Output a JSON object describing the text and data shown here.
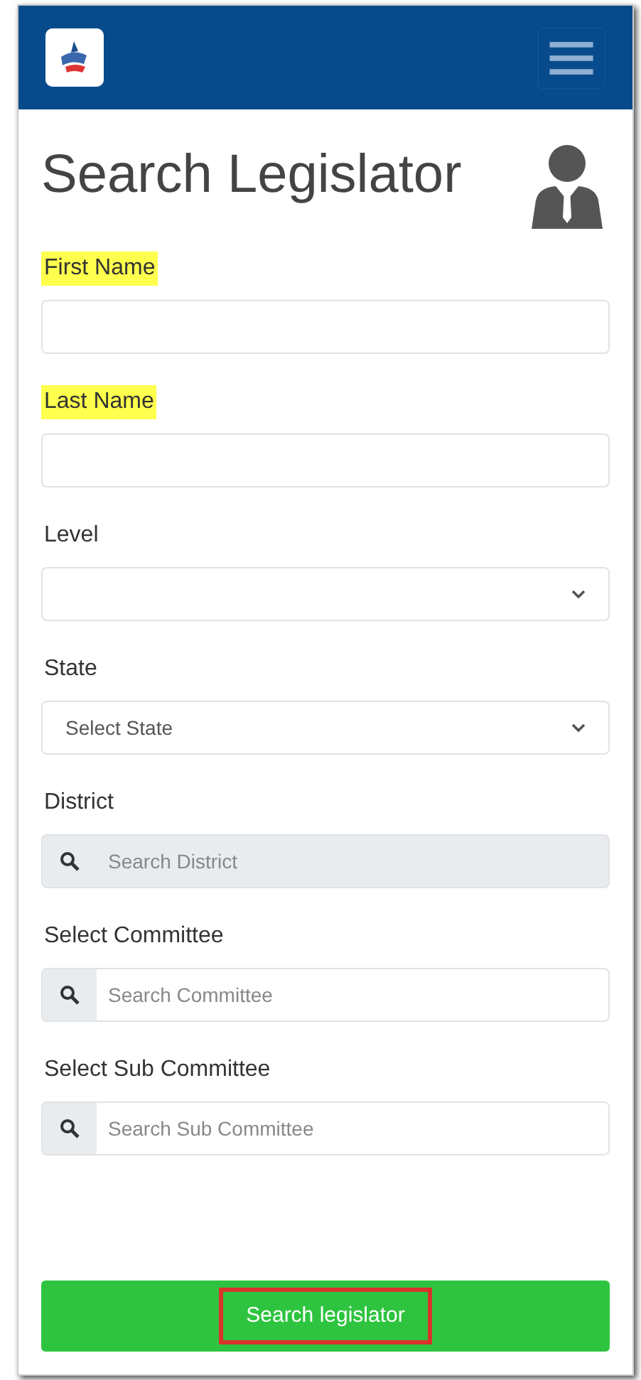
{
  "title": "Search Legislator",
  "fields": [
    {
      "kind": "text",
      "label": "First Name",
      "highlighted": true,
      "disabled": false
    },
    {
      "kind": "text",
      "label": "Last Name",
      "highlighted": true,
      "disabled": false
    },
    {
      "kind": "select",
      "label": "Level",
      "highlighted": false,
      "disabled": false
    },
    {
      "kind": "select",
      "label": "State",
      "highlighted": false,
      "disabled": false,
      "value": "Select State"
    },
    {
      "kind": "search",
      "label": "District",
      "highlighted": false,
      "disabled": true,
      "placeholder": "Search District"
    },
    {
      "kind": "search",
      "label": "Select Committee",
      "highlighted": false,
      "disabled": false,
      "placeholder": "Search Committee"
    },
    {
      "kind": "search",
      "label": "Select Sub Committee",
      "highlighted": false,
      "disabled": false,
      "placeholder": "Search Sub Committee"
    }
  ],
  "submit": {
    "label": "Search legislator",
    "annotated": true
  }
}
